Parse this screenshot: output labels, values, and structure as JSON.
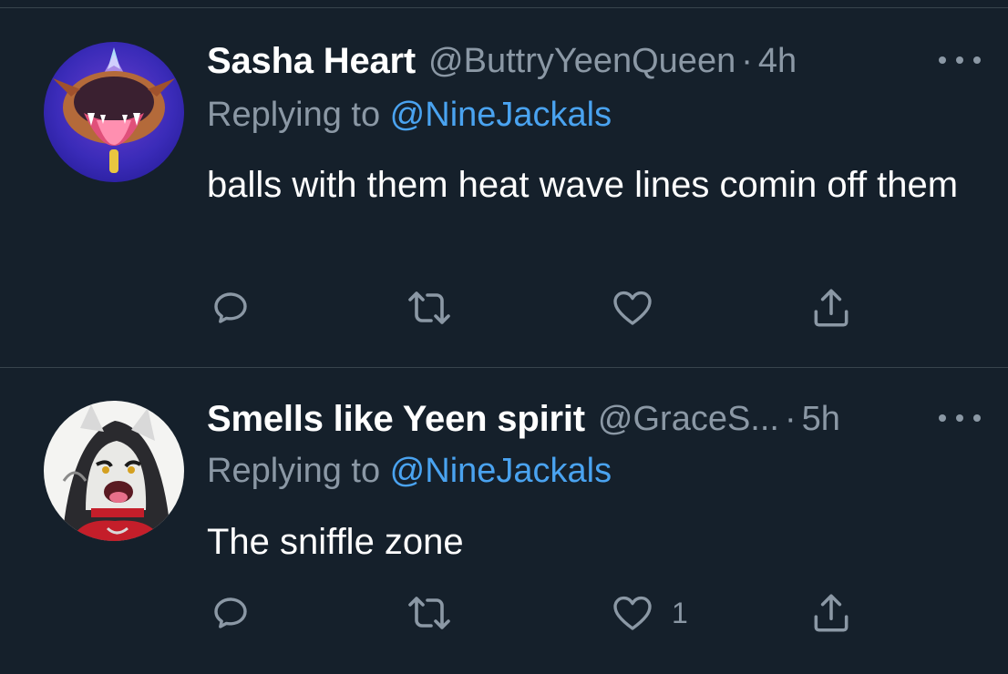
{
  "tweets": [
    {
      "display_name": "Sasha Heart",
      "handle": "@ButtryYeenQueen",
      "separator": "·",
      "time": "4h",
      "replying_prefix": "Replying to ",
      "replying_to": "@NineJackals",
      "text": "balls with them heat wave lines comin off them",
      "reply_count": "",
      "retweet_count": "",
      "like_count": ""
    },
    {
      "display_name": "Smells like Yeen spirit",
      "handle": "@GraceS...",
      "separator": "·",
      "time": "5h",
      "replying_prefix": "Replying to ",
      "replying_to": "@NineJackals",
      "text": "The sniffle zone",
      "reply_count": "",
      "retweet_count": "",
      "like_count": "1"
    }
  ],
  "icons": {
    "reply": "reply-icon",
    "retweet": "retweet-icon",
    "like": "heart-icon",
    "share": "share-icon",
    "more": "more-icon"
  },
  "colors": {
    "background": "#15202b",
    "divider": "#38444d",
    "secondary_text": "#8b98a5",
    "mention": "#4aa3f0"
  }
}
